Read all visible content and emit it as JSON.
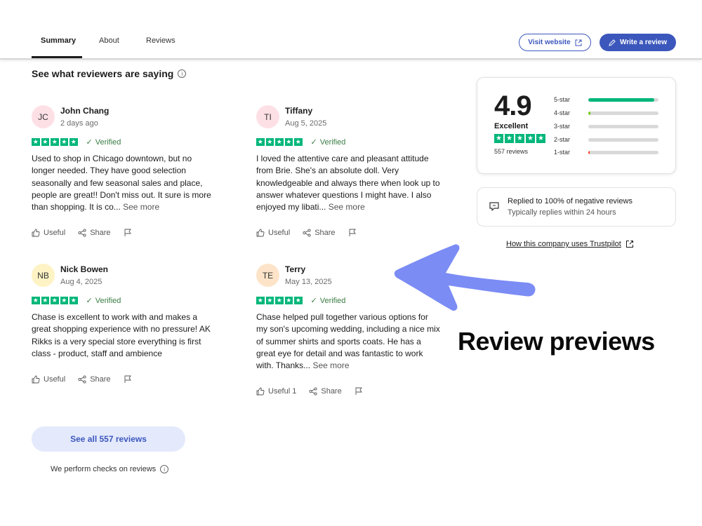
{
  "nav": {
    "tabs": [
      {
        "label": "Summary",
        "active": true
      },
      {
        "label": "About",
        "active": false
      },
      {
        "label": "Reviews",
        "active": false
      }
    ],
    "visit_website": "Visit website",
    "write_review": "Write a review"
  },
  "section_title": "See what reviewers are saying",
  "reviews": [
    {
      "initials": "JC",
      "avatar_color": "#fde0e6",
      "name": "John Chang",
      "date": "2 days ago",
      "stars": 5,
      "verified": "Verified",
      "text": "Used to shop in Chicago downtown, but no longer needed. They have good selection seasonally and few seasonal sales and place, people are great!! Don't miss out. It sure is more than shopping. It is co...",
      "see_more": "See more",
      "useful": "Useful",
      "share": "Share"
    },
    {
      "initials": "TI",
      "avatar_color": "#fde0e6",
      "name": "Tiffany",
      "date": "Aug 5, 2025",
      "stars": 5,
      "verified": "Verified",
      "text": "I loved the attentive care and pleasant attitude from Brie. She's an absolute doll. Very knowledgeable and always there when look up to answer whatever questions I might have. I also enjoyed my libati...",
      "see_more": "See more",
      "useful": "Useful",
      "share": "Share"
    },
    {
      "initials": "NB",
      "avatar_color": "#fdf3c4",
      "name": "Nick Bowen",
      "date": "Aug 4, 2025",
      "stars": 5,
      "verified": "Verified",
      "text": "Chase is excellent to work with and makes a great shopping experience with no pressure! AK Rikks is a very special store everything is first class - product, staff and ambience",
      "see_more": "",
      "useful": "Useful",
      "share": "Share"
    },
    {
      "initials": "TE",
      "avatar_color": "#fde4c8",
      "name": "Terry",
      "date": "May 13, 2025",
      "stars": 5,
      "verified": "Verified",
      "text": "Chase helped pull together various options for my son's upcoming wedding, including a nice mix of summer shirts and sports coats. He has a great eye for detail and was fantastic to work with. Thanks...",
      "see_more": "See more",
      "useful": "Useful 1",
      "share": "Share"
    }
  ],
  "summary": {
    "score": "4.9",
    "label": "Excellent",
    "count": "557 reviews",
    "distribution": [
      {
        "label": "5-star",
        "fraction": 0.94,
        "color": "#00b67a"
      },
      {
        "label": "4-star",
        "fraction": 0.03,
        "color": "#73cf11"
      },
      {
        "label": "3-star",
        "fraction": 0.0,
        "color": "#ffce00"
      },
      {
        "label": "2-star",
        "fraction": 0.0,
        "color": "#ff8622"
      },
      {
        "label": "1-star",
        "fraction": 0.02,
        "color": "#ff3722"
      }
    ]
  },
  "reply": {
    "line1": "Replied to 100% of negative reviews",
    "line2": "Typically replies within 24 hours"
  },
  "how_link": "How this company uses Trustpilot",
  "annotation": "Review previews",
  "see_all": "See all 557 reviews",
  "checks_note": "We perform checks on reviews",
  "colors": {
    "brand_blue": "#3c57bc",
    "trustpilot_green": "#00b67a",
    "arrow": "#7b8cf5"
  }
}
